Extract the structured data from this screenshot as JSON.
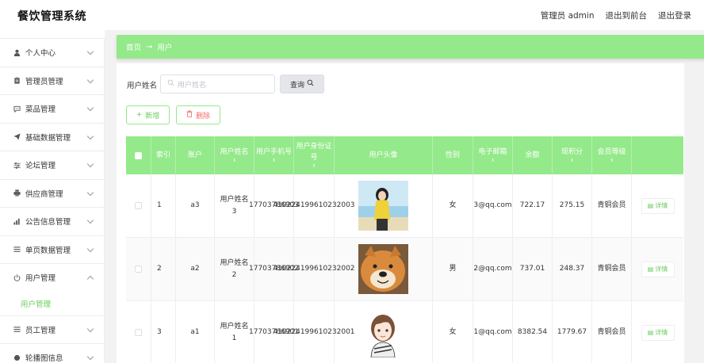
{
  "app": {
    "title": "餐饮管理系统"
  },
  "topnav": {
    "admin": "管理员 admin",
    "to_front": "退出到前台",
    "logout": "退出登录"
  },
  "sidebar": {
    "items": [
      {
        "label": "个人中心",
        "icon": "person-icon"
      },
      {
        "label": "管理员管理",
        "icon": "clipboard-icon"
      },
      {
        "label": "菜品管理",
        "icon": "chat-icon"
      },
      {
        "label": "基础数据管理",
        "icon": "send-icon"
      },
      {
        "label": "论坛管理",
        "icon": "sliders-icon"
      },
      {
        "label": "供应商管理",
        "icon": "printer-icon"
      },
      {
        "label": "公告信息管理",
        "icon": "chart-icon"
      },
      {
        "label": "单页数据管理",
        "icon": "menu-icon"
      },
      {
        "label": "用户管理",
        "icon": "power-icon"
      },
      {
        "label": "员工管理",
        "icon": "menu-icon"
      },
      {
        "label": "轮播图信息",
        "icon": "circle-icon"
      }
    ],
    "active_sub": "用户管理"
  },
  "breadcrumb": {
    "home": "首页",
    "sep": "→",
    "current": "用户"
  },
  "search": {
    "label": "用户姓名",
    "placeholder": "用户姓名",
    "button": "查询"
  },
  "actions": {
    "add": "新增",
    "delete": "删除"
  },
  "table": {
    "headers": {
      "index": "索引",
      "account": "账户",
      "name": "用户姓名",
      "phone": "用户手机号",
      "idcard": "用户身份证号",
      "photo": "用户头像",
      "sex": "性别",
      "email": "电子邮箱",
      "balance": "余额",
      "points": "现积分",
      "level": "会员等级"
    },
    "rows": [
      {
        "index": "1",
        "account": "a3",
        "name": "用户姓名3",
        "phone": "17703786903",
        "idcard": "410224199610232003",
        "sex": "女",
        "email": "3@qq.com",
        "balance": "722.17",
        "points": "275.15",
        "level": "青铜会员",
        "detail": "详情"
      },
      {
        "index": "2",
        "account": "a2",
        "name": "用户姓名2",
        "phone": "17703786902",
        "idcard": "410224199610232002",
        "sex": "男",
        "email": "2@qq.com",
        "balance": "737.01",
        "points": "248.37",
        "level": "青铜会员",
        "detail": "详情"
      },
      {
        "index": "3",
        "account": "a1",
        "name": "用户姓名1",
        "phone": "17703786901",
        "idcard": "410224199610232001",
        "sex": "女",
        "email": "1@qq.com",
        "balance": "8382.54",
        "points": "1779.67",
        "level": "青铜会员",
        "detail": "详情"
      }
    ]
  },
  "colors": {
    "accent": "#94e98a",
    "accent_text": "#6acc5c",
    "danger": "#f56c6c"
  }
}
